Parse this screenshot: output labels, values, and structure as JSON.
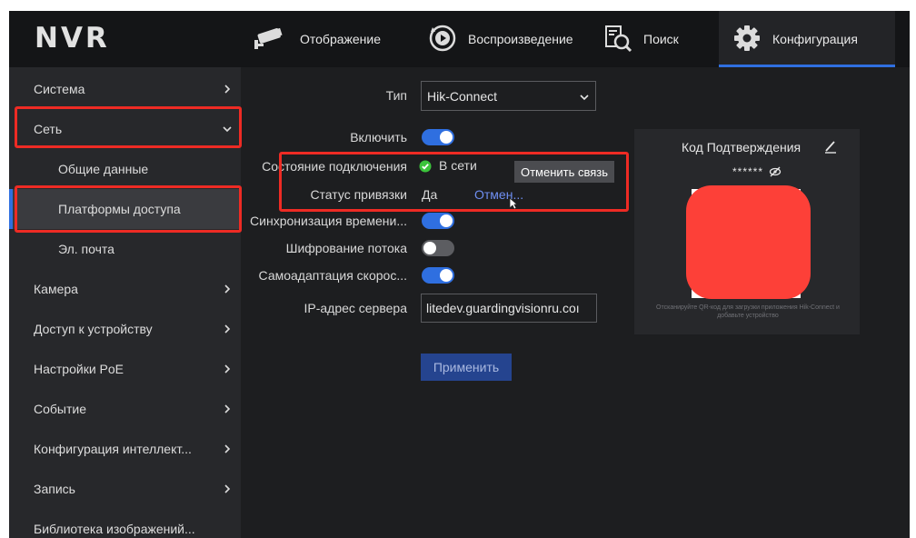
{
  "app": {
    "logo": "NVR"
  },
  "nav": {
    "tabs": [
      {
        "label": "Отображение",
        "icon": "camera-icon"
      },
      {
        "label": "Воспроизведение",
        "icon": "playback-icon"
      },
      {
        "label": "Поиск",
        "icon": "search-icon"
      },
      {
        "label": "Конфигурация",
        "icon": "gear-icon",
        "active": true
      }
    ]
  },
  "sidebar": {
    "items": [
      {
        "label": "Система"
      },
      {
        "label": "Сеть",
        "expanded": true
      },
      {
        "label": "Общие данные",
        "sub": true
      },
      {
        "label": "Платформы доступа",
        "sub": true,
        "selected": true
      },
      {
        "label": "Эл. почта",
        "sub": true
      },
      {
        "label": "Камера"
      },
      {
        "label": "Доступ к устройству"
      },
      {
        "label": "Настройки PoE"
      },
      {
        "label": "Событие"
      },
      {
        "label": "Конфигурация интеллект..."
      },
      {
        "label": "Запись"
      },
      {
        "label": "Библиотека изображений..."
      }
    ]
  },
  "form": {
    "type_label": "Тип",
    "type_value": "Hik-Connect",
    "enable_label": "Включить",
    "enable_on": true,
    "conn_status_label": "Состояние подключения",
    "conn_status_value": "В сети",
    "bind_status_label": "Статус привязки",
    "bind_status_value": "Да",
    "unbind_link": "Отмен...",
    "tooltip": "Отменить связь",
    "time_sync_label": "Синхронизация времени...",
    "time_sync_on": true,
    "stream_enc_label": "Шифрование потока",
    "stream_enc_on": false,
    "adaptive_label": "Самоадаптация скорос...",
    "adaptive_on": true,
    "server_label": "IP-адрес сервера",
    "server_value": "litedev.guardingvisionru.coı",
    "apply": "Применить"
  },
  "qr_panel": {
    "title": "Код Подтверждения",
    "code_masked": "******",
    "hint": "Отсканируйте QR-код для загрузки приложения Hik-Connect и добавьте устройство"
  },
  "colors": {
    "accent": "#2f6fe0",
    "highlight": "#ee2b24",
    "online": "#3bc43b",
    "redaction": "#fd4038"
  }
}
